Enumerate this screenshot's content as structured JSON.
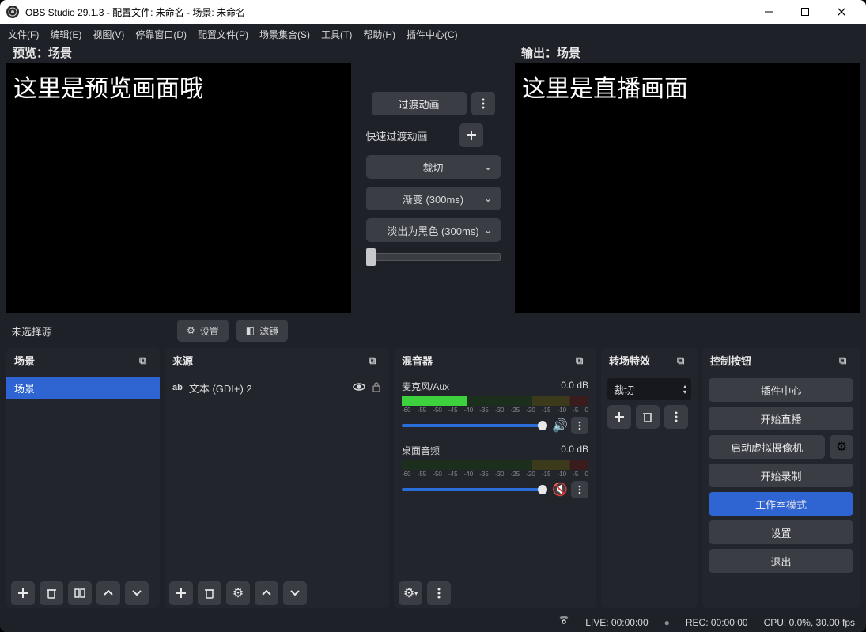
{
  "title": "OBS Studio 29.1.3 - 配置文件: 未命名 - 场景: 未命名",
  "menu": [
    "文件(F)",
    "编辑(E)",
    "视图(V)",
    "停靠窗口(D)",
    "配置文件(P)",
    "场景集合(S)",
    "工具(T)",
    "帮助(H)",
    "插件中心(C)"
  ],
  "preview": {
    "label": "预览：场景",
    "text": "这里是预览画面哦"
  },
  "program": {
    "label": "输出：场景",
    "text": "这里是直播画面"
  },
  "center": {
    "transition_btn": "过渡动画",
    "quick_label": "快速过渡动画",
    "sel1": "裁切",
    "sel2": "渐变 (300ms)",
    "sel3": "淡出为黑色 (300ms)"
  },
  "toolbar": {
    "no_selection": "未选择源",
    "settings": "设置",
    "filters": "滤镜"
  },
  "panels": {
    "scenes": {
      "title": "场景",
      "items": [
        "场景"
      ]
    },
    "sources": {
      "title": "来源",
      "items": [
        {
          "icon": "ab",
          "name": "文本 (GDI+) 2"
        }
      ]
    },
    "mixer": {
      "title": "混音器",
      "channels": [
        {
          "name": "麦克风/Aux",
          "db": "0.0 dB",
          "muted": false,
          "ticks": [
            "-60",
            "-55",
            "-50",
            "-45",
            "-40",
            "-35",
            "-30",
            "-25",
            "-20",
            "-15",
            "-10",
            "-5",
            "0"
          ]
        },
        {
          "name": "桌面音频",
          "db": "0.0 dB",
          "muted": true,
          "ticks": [
            "-60",
            "-55",
            "-50",
            "-45",
            "-40",
            "-35",
            "-30",
            "-25",
            "-20",
            "-15",
            "-10",
            "-5",
            "0"
          ]
        }
      ]
    },
    "transitions": {
      "title": "转场特效",
      "selected": "裁切"
    },
    "controls": {
      "title": "控制按钮",
      "buttons": {
        "plugin_center": "插件中心",
        "start_stream": "开始直播",
        "start_vcam": "启动虚拟摄像机",
        "start_record": "开始录制",
        "studio_mode": "工作室模式",
        "settings": "设置",
        "exit": "退出"
      }
    }
  },
  "status": {
    "live": "LIVE: 00:00:00",
    "rec": "REC: 00:00:00",
    "cpu": "CPU: 0.0%, 30.00 fps"
  }
}
